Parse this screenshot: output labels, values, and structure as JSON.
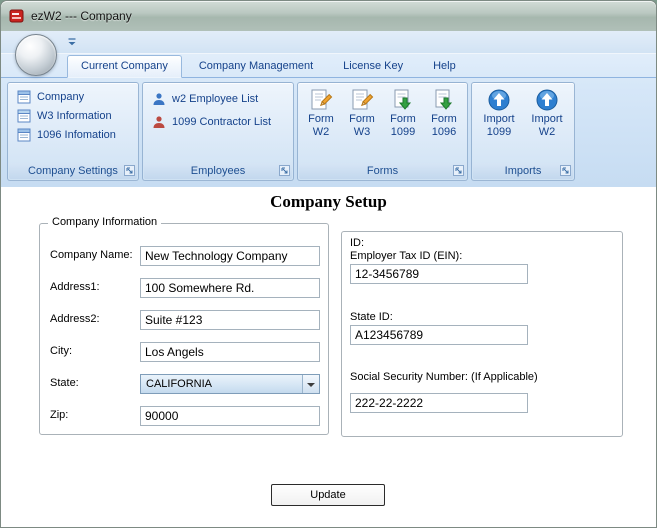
{
  "window": {
    "title": "ezW2 --- Company"
  },
  "tabs": [
    {
      "label": "Current Company"
    },
    {
      "label": "Company Management"
    },
    {
      "label": "License Key"
    },
    {
      "label": "Help"
    }
  ],
  "groups": {
    "settings": {
      "caption": "Company Settings",
      "items": [
        {
          "label": "Company"
        },
        {
          "label": "W3 Information"
        },
        {
          "label": "1096 Infomation"
        }
      ]
    },
    "employees": {
      "caption": "Employees",
      "items": [
        {
          "label": "w2 Employee List"
        },
        {
          "label": "1099 Contractor List"
        }
      ]
    },
    "forms": {
      "caption": "Forms",
      "items": [
        {
          "line1": "Form",
          "line2": "W2"
        },
        {
          "line1": "Form",
          "line2": "W3"
        },
        {
          "line1": "Form",
          "line2": "1099"
        },
        {
          "line1": "Form",
          "line2": "1096"
        }
      ]
    },
    "imports": {
      "caption": "Imports",
      "items": [
        {
          "line1": "Import",
          "line2": "1099"
        },
        {
          "line1": "Import",
          "line2": "W2"
        }
      ]
    }
  },
  "main": {
    "title": "Company Setup",
    "company_info": {
      "legend": "Company Information",
      "fields": [
        {
          "label": "Company Name:",
          "value": "New Technology Company"
        },
        {
          "label": "Address1:",
          "value": "100 Somewhere Rd."
        },
        {
          "label": "Address2:",
          "value": "Suite #123"
        },
        {
          "label": "City:",
          "value": "Los Angels"
        },
        {
          "label": "State:",
          "value": "CALIFORNIA"
        },
        {
          "label": "Zip:",
          "value": "90000"
        }
      ]
    },
    "ids": {
      "id_label": "ID:",
      "ein_label": "Employer Tax ID (EIN):",
      "ein_value": "12-3456789",
      "state_id_label": "State ID:",
      "state_id_value": "A123456789",
      "ssn_label": "Social Security Number: (If Applicable)",
      "ssn_value": "222-22-2222"
    },
    "update_label": "Update"
  }
}
